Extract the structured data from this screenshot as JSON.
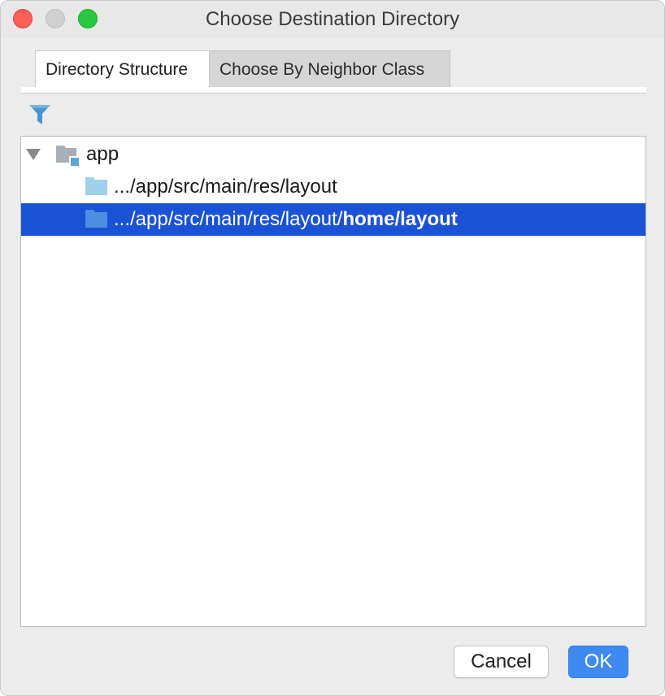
{
  "window": {
    "title": "Choose Destination Directory"
  },
  "tabs": [
    {
      "label": "Directory Structure",
      "active": true
    },
    {
      "label": "Choose By Neighbor Class",
      "active": false
    }
  ],
  "toolbar": {
    "filter_icon": "filter-icon"
  },
  "tree": {
    "root": {
      "label": "app",
      "expanded": true,
      "icon": "module-folder-icon"
    },
    "children": [
      {
        "prefix": ".../app/src/main/res/layout",
        "suffix": "",
        "selected": false,
        "icon": "folder-icon"
      },
      {
        "prefix": ".../app/src/main/res/layout/",
        "suffix": "home/layout",
        "selected": true,
        "icon": "folder-icon"
      }
    ]
  },
  "buttons": {
    "cancel_label": "Cancel",
    "ok_label": "OK"
  },
  "colors": {
    "selection": "#1a52d6",
    "primary_button": "#3d8bf0",
    "folder_light": "#9fd1ea",
    "folder_selected": "#4a8fe0"
  }
}
